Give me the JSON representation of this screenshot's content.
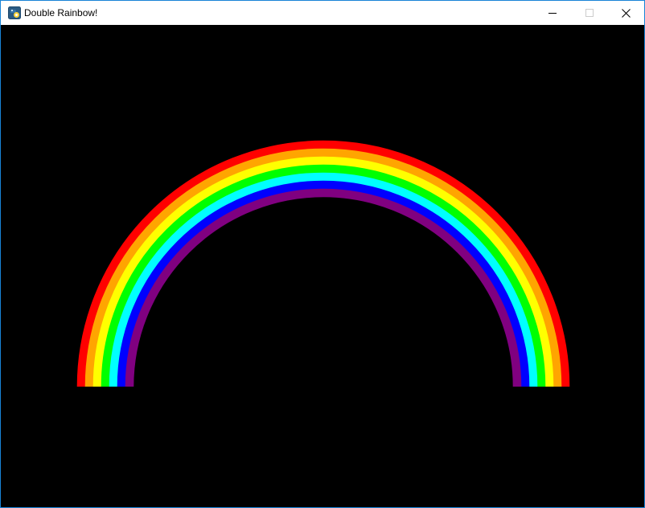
{
  "window": {
    "title": "Double Rainbow!",
    "icon": "python-icon",
    "controls": [
      {
        "name": "minimize",
        "icon": "minimize-icon",
        "enabled": true
      },
      {
        "name": "maximize",
        "icon": "maximize-icon",
        "enabled": false
      },
      {
        "name": "close",
        "icon": "close-icon",
        "enabled": true
      }
    ]
  },
  "canvas": {
    "background": "#000000",
    "rainbow": {
      "bands": [
        {
          "name": "red",
          "color": "#ff0000"
        },
        {
          "name": "orange",
          "color": "#ffa500"
        },
        {
          "name": "yellow",
          "color": "#ffff00"
        },
        {
          "name": "green",
          "color": "#00ff00"
        },
        {
          "name": "cyan",
          "color": "#00ffff"
        },
        {
          "name": "blue",
          "color": "#0000ff"
        },
        {
          "name": "purple",
          "color": "#800080"
        }
      ]
    }
  }
}
